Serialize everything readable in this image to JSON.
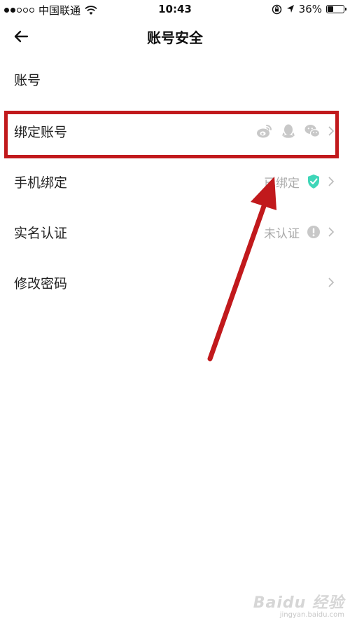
{
  "status_bar": {
    "carrier": "中国联通",
    "time": "10:43",
    "battery": "36%",
    "battery_level": 0.36,
    "icons": [
      "signal-dots",
      "wifi-icon",
      "orientation-lock-icon",
      "location-arrow-icon",
      "battery-icon"
    ]
  },
  "nav": {
    "back_icon": "arrow-left-icon",
    "title": "账号安全"
  },
  "rows": {
    "account": {
      "label": "账号"
    },
    "bind_account": {
      "label": "绑定账号",
      "icons": [
        "weibo-icon",
        "qq-icon",
        "wechat-icon"
      ],
      "chevron": "chevron-right-icon"
    },
    "phone_bind": {
      "label": "手机绑定",
      "status": "已绑定",
      "status_icon": "verified-shield-icon",
      "status_color": "#3fd6b8",
      "chevron": "chevron-right-icon"
    },
    "real_name": {
      "label": "实名认证",
      "status": "未认证",
      "status_icon": "exclamation-circle-icon",
      "chevron": "chevron-right-icon"
    },
    "change_password": {
      "label": "修改密码",
      "chevron": "chevron-right-icon"
    }
  },
  "annotation": {
    "color": "#c1191c"
  },
  "watermark": {
    "logo": "Baidu 经验",
    "sub": "jingyan.baidu.com"
  }
}
